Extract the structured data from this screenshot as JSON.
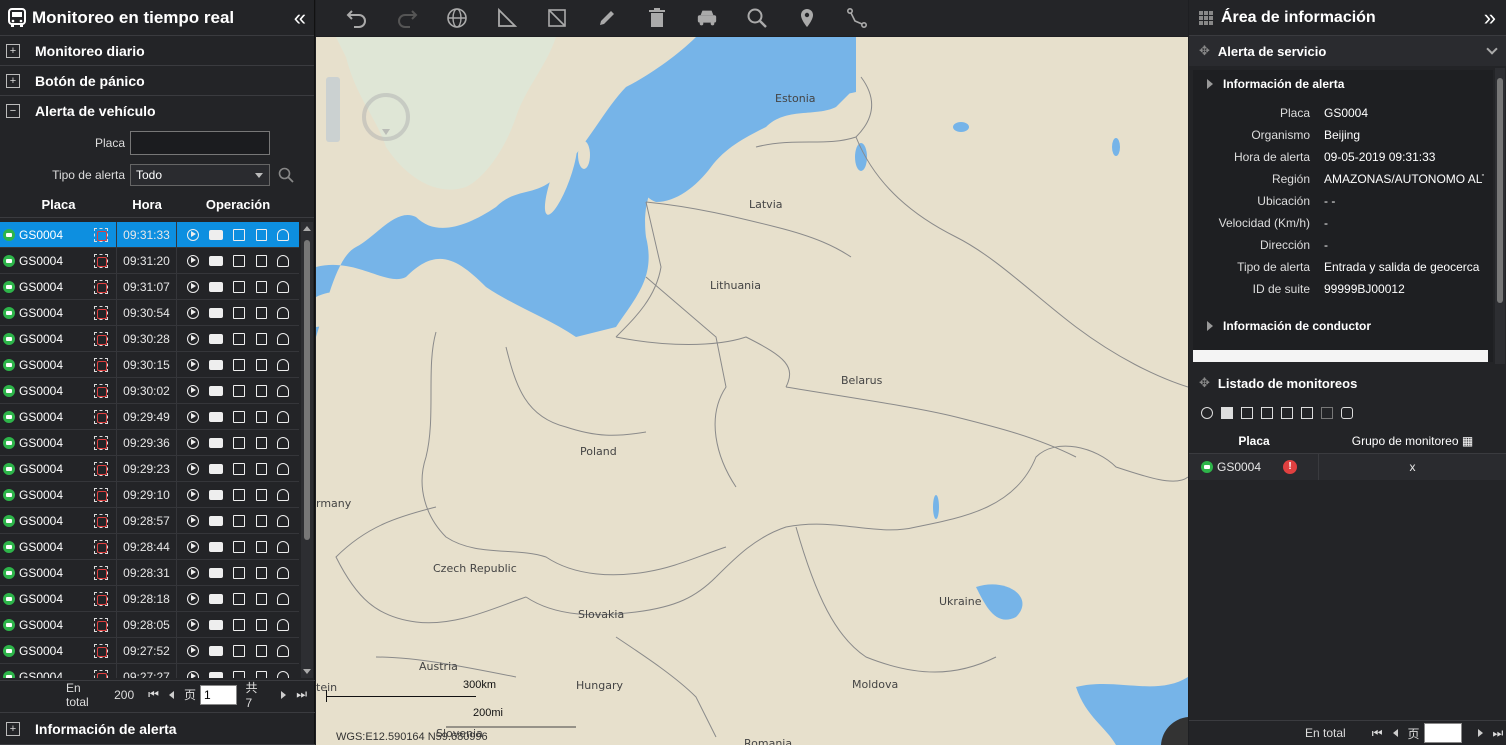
{
  "left": {
    "title": "Monitoreo en tiempo real",
    "sections": {
      "daily": "Monitoreo diario",
      "panic": "Botón de pánico",
      "vehicle_alert": "Alerta de vehículo"
    },
    "filters": {
      "plate_label": "Placa",
      "plate_value": "",
      "type_label": "Tipo de alerta",
      "type_value": "Todo"
    },
    "table": {
      "headers": [
        "Placa",
        "Hora",
        "Operación"
      ],
      "rows": [
        {
          "plate": "GS0004",
          "time": "09:31:33"
        },
        {
          "plate": "GS0004",
          "time": "09:31:20"
        },
        {
          "plate": "GS0004",
          "time": "09:31:07"
        },
        {
          "plate": "GS0004",
          "time": "09:30:54"
        },
        {
          "plate": "GS0004",
          "time": "09:30:28"
        },
        {
          "plate": "GS0004",
          "time": "09:30:15"
        },
        {
          "plate": "GS0004",
          "time": "09:30:02"
        },
        {
          "plate": "GS0004",
          "time": "09:29:49"
        },
        {
          "plate": "GS0004",
          "time": "09:29:36"
        },
        {
          "plate": "GS0004",
          "time": "09:29:23"
        },
        {
          "plate": "GS0004",
          "time": "09:29:10"
        },
        {
          "plate": "GS0004",
          "time": "09:28:57"
        },
        {
          "plate": "GS0004",
          "time": "09:28:44"
        },
        {
          "plate": "GS0004",
          "time": "09:28:31"
        },
        {
          "plate": "GS0004",
          "time": "09:28:18"
        },
        {
          "plate": "GS0004",
          "time": "09:28:05"
        },
        {
          "plate": "GS0004",
          "time": "09:27:52"
        },
        {
          "plate": "GS0004",
          "time": "09:27:27"
        }
      ]
    },
    "pager": {
      "total_label": "En total",
      "total": "200",
      "page_label": "页",
      "page_value": "1",
      "pages_label": "共 7"
    },
    "footer": "Información de alerta"
  },
  "toolbar": [
    "undo-icon",
    "redo-icon",
    "globe-icon",
    "measure-angle-icon",
    "measure-area-icon",
    "pencil-icon",
    "trash-icon",
    "vehicle-icon",
    "search-icon",
    "pin-icon",
    "route-icon"
  ],
  "map": {
    "labels": {
      "estonia": "Estonia",
      "latvia": "Latvia",
      "lithuania": "Lithuania",
      "belarus": "Belarus",
      "poland": "Poland",
      "germany": "rmany",
      "czech": "Czech Republic",
      "slovakia": "Slovakia",
      "austria": "Austria",
      "hungary": "Hungary",
      "moldova": "Moldova",
      "ukraine": "Ukraine",
      "romania": "Romania",
      "slovenia": "Slovenia",
      "liechtenstein": "tein"
    },
    "scale_km": "300km",
    "scale_mi": "200mi",
    "coords": "WGS:E12.590164  N59.680996"
  },
  "right": {
    "title": "Área de información",
    "service_alert": "Alerta de servicio",
    "alert_info": "Información de alerta",
    "fields": [
      {
        "k": "Placa",
        "v": "GS0004"
      },
      {
        "k": "Organismo",
        "v": "Beijing"
      },
      {
        "k": "Hora de alerta",
        "v": "09-05-2019 09:31:33"
      },
      {
        "k": "Región",
        "v": "AMAZONAS/AUTONOMO ALT"
      },
      {
        "k": "Ubicación",
        "v": "- -"
      },
      {
        "k": "Velocidad (Km/h)",
        "v": "-"
      },
      {
        "k": "Dirección",
        "v": "-"
      },
      {
        "k": "Tipo de alerta",
        "v": "Entrada y salida de geocerca"
      },
      {
        "k": "ID de suite",
        "v": "99999BJ00012"
      }
    ],
    "driver_info": "Información de conductor",
    "monitor_list": "Listado de monitoreos",
    "list_headers": [
      "Placa",
      "Grupo de monitoreo"
    ],
    "list_rows": [
      {
        "plate": "GS0004",
        "group": "x"
      }
    ],
    "footer_total": "En total",
    "footer_page": "页"
  },
  "colors": {
    "selected": "#0d8fe0",
    "online": "#2eb54a",
    "alarm": "#e04040",
    "sea": "#76b4e8",
    "land": "#e7e0cc"
  }
}
